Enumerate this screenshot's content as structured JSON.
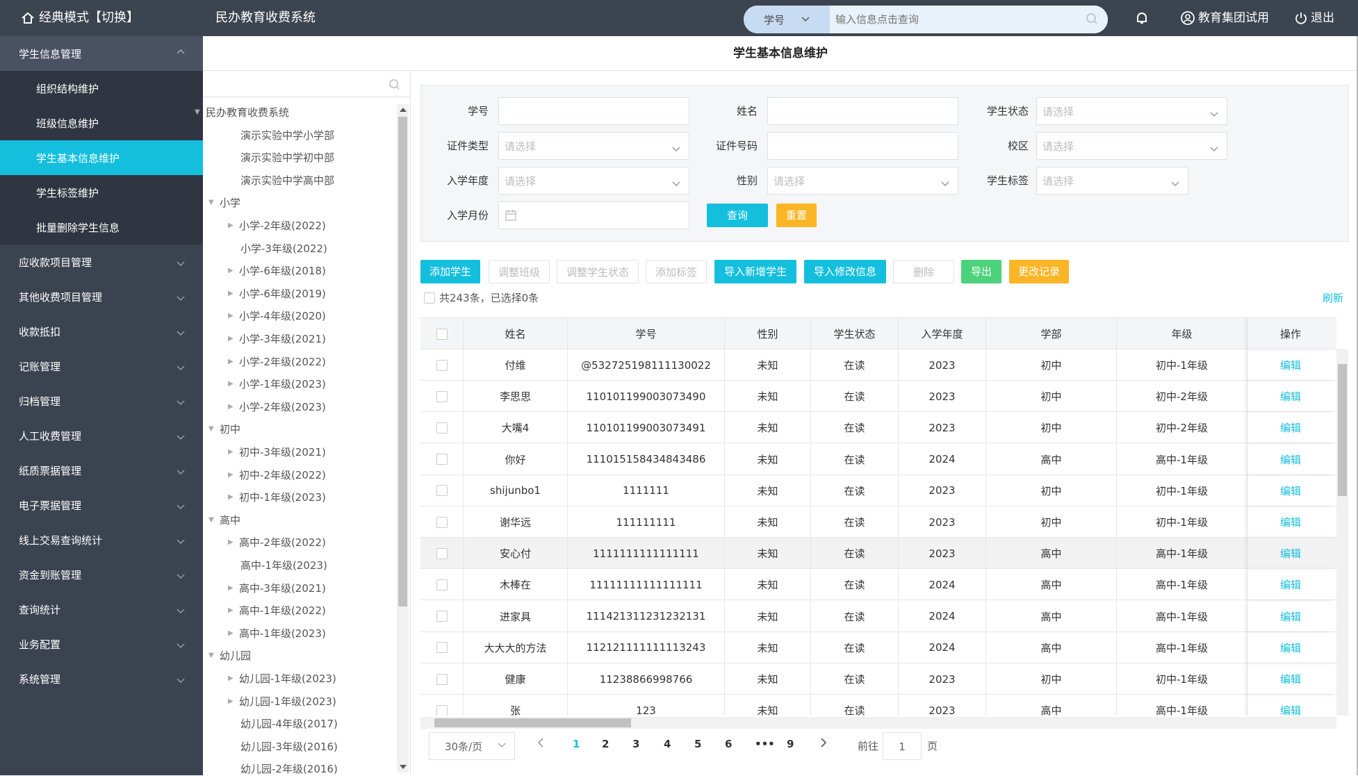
{
  "topbar": {
    "mode_label": "经典模式【切换】",
    "system_name": "民办教育收费系统",
    "search_field": "学号",
    "search_placeholder": "输入信息点击查询",
    "user": "教育集团试用",
    "logout": "退出"
  },
  "sidebar": {
    "open_group": "学生信息管理",
    "sub_items": [
      "组织结构维护",
      "班级信息维护",
      "学生基本信息维护",
      "学生标签维护",
      "批量删除学生信息"
    ],
    "active_sub": "学生基本信息维护",
    "groups": [
      "应收款项目管理",
      "其他收费项目管理",
      "收款抵扣",
      "记账管理",
      "归档管理",
      "人工收费管理",
      "纸质票据管理",
      "电子票据管理",
      "线上交易查询统计",
      "资金到账管理",
      "查询统计",
      "业务配置",
      "系统管理"
    ]
  },
  "page_title": "学生基本信息维护",
  "tree": [
    {
      "label": "民办教育收费系统",
      "level": 0,
      "arrow": "open"
    },
    {
      "label": "演示实验中学小学部",
      "level": 2,
      "arrow": "none"
    },
    {
      "label": "演示实验中学初中部",
      "level": 2,
      "arrow": "none"
    },
    {
      "label": "演示实验中学高中部",
      "level": 2,
      "arrow": "none"
    },
    {
      "label": "小学",
      "level": 1,
      "arrow": "open"
    },
    {
      "label": "小学-2年级(2022)",
      "level": 2,
      "arrow": "closed"
    },
    {
      "label": "小学-3年级(2022)",
      "level": 2,
      "arrow": "none"
    },
    {
      "label": "小学-6年级(2018)",
      "level": 2,
      "arrow": "closed"
    },
    {
      "label": "小学-6年级(2019)",
      "level": 2,
      "arrow": "closed"
    },
    {
      "label": "小学-4年级(2020)",
      "level": 2,
      "arrow": "closed"
    },
    {
      "label": "小学-3年级(2021)",
      "level": 2,
      "arrow": "closed"
    },
    {
      "label": "小学-2年级(2022)",
      "level": 2,
      "arrow": "closed"
    },
    {
      "label": "小学-1年级(2023)",
      "level": 2,
      "arrow": "closed"
    },
    {
      "label": "小学-2年级(2023)",
      "level": 2,
      "arrow": "closed"
    },
    {
      "label": "初中",
      "level": 1,
      "arrow": "open"
    },
    {
      "label": "初中-3年级(2021)",
      "level": 2,
      "arrow": "closed"
    },
    {
      "label": "初中-2年级(2022)",
      "level": 2,
      "arrow": "closed"
    },
    {
      "label": "初中-1年级(2023)",
      "level": 2,
      "arrow": "closed"
    },
    {
      "label": "高中",
      "level": 1,
      "arrow": "open"
    },
    {
      "label": "高中-2年级(2022)",
      "level": 2,
      "arrow": "closed"
    },
    {
      "label": "高中-1年级(2023)",
      "level": 2,
      "arrow": "none"
    },
    {
      "label": "高中-3年级(2021)",
      "level": 2,
      "arrow": "closed"
    },
    {
      "label": "高中-1年级(2022)",
      "level": 2,
      "arrow": "closed"
    },
    {
      "label": "高中-1年级(2023)",
      "level": 2,
      "arrow": "closed"
    },
    {
      "label": "幼儿园",
      "level": 1,
      "arrow": "open"
    },
    {
      "label": "幼儿园-1年级(2023)",
      "level": 2,
      "arrow": "closed"
    },
    {
      "label": "幼儿园-1年级(2023)",
      "level": 2,
      "arrow": "closed"
    },
    {
      "label": "幼儿园-4年级(2017)",
      "level": 2,
      "arrow": "none"
    },
    {
      "label": "幼儿园-3年级(2016)",
      "level": 2,
      "arrow": "none"
    },
    {
      "label": "幼儿园-2年级(2016)",
      "level": 2,
      "arrow": "none"
    }
  ],
  "filter": {
    "student_no_label": "学号",
    "name_label": "姓名",
    "status_label": "学生状态",
    "id_type_label": "证件类型",
    "id_no_label": "证件号码",
    "campus_label": "校区",
    "year_label": "入学年度",
    "gender_label": "性别",
    "tag_label": "学生标签",
    "month_label": "入学月份",
    "select_placeholder": "请选择",
    "query_button": "查询",
    "reset_button": "重置"
  },
  "actions": {
    "add": "添加学生",
    "adjust_class": "调整班级",
    "adjust_status": "调整学生状态",
    "add_tag": "添加标签",
    "import_new": "导入新增学生",
    "import_modify": "导入修改信息",
    "delete": "删除",
    "export": "导出",
    "change_log": "更改记录"
  },
  "summary": "共243条，已选择0条",
  "refresh": "刷新",
  "columns": [
    "姓名",
    "学号",
    "性别",
    "学生状态",
    "入学年度",
    "学部",
    "年级",
    "操作"
  ],
  "rows": [
    {
      "name": "付维",
      "no": "@532725198111130022",
      "gender": "未知",
      "status": "在读",
      "year": "2023",
      "dept": "初中",
      "grade": "初中-1年级",
      "op": "编辑"
    },
    {
      "name": "李思思",
      "no": "110101199003073490",
      "gender": "未知",
      "status": "在读",
      "year": "2023",
      "dept": "初中",
      "grade": "初中-2年级",
      "op": "编辑"
    },
    {
      "name": "大嘴4",
      "no": "110101199003073491",
      "gender": "未知",
      "status": "在读",
      "year": "2023",
      "dept": "初中",
      "grade": "初中-2年级",
      "op": "编辑"
    },
    {
      "name": "你好",
      "no": "111015158434843486",
      "gender": "未知",
      "status": "在读",
      "year": "2024",
      "dept": "高中",
      "grade": "高中-1年级",
      "op": "编辑"
    },
    {
      "name": "shijunbo1",
      "no": "1111111",
      "gender": "未知",
      "status": "在读",
      "year": "2023",
      "dept": "初中",
      "grade": "初中-1年级",
      "op": "编辑"
    },
    {
      "name": "谢华远",
      "no": "111111111",
      "gender": "未知",
      "status": "在读",
      "year": "2023",
      "dept": "初中",
      "grade": "初中-1年级",
      "op": "编辑"
    },
    {
      "name": "安心付",
      "no": "1111111111111111",
      "gender": "未知",
      "status": "在读",
      "year": "2023",
      "dept": "高中",
      "grade": "高中-1年级",
      "op": "编辑"
    },
    {
      "name": "木棒在",
      "no": "11111111111111111",
      "gender": "未知",
      "status": "在读",
      "year": "2024",
      "dept": "高中",
      "grade": "高中-1年级",
      "op": "编辑"
    },
    {
      "name": "进家具",
      "no": "111421311231232131",
      "gender": "未知",
      "status": "在读",
      "year": "2024",
      "dept": "高中",
      "grade": "高中-1年级",
      "op": "编辑"
    },
    {
      "name": "大大大的方法",
      "no": "112121111111113243",
      "gender": "未知",
      "status": "在读",
      "year": "2024",
      "dept": "高中",
      "grade": "高中-1年级",
      "op": "编辑"
    },
    {
      "name": "健康",
      "no": "11238866998766",
      "gender": "未知",
      "status": "在读",
      "year": "2023",
      "dept": "初中",
      "grade": "初中-1年级",
      "op": "编辑"
    },
    {
      "name": "张",
      "no": "123",
      "gender": "未知",
      "status": "在读",
      "year": "2023",
      "dept": "高中",
      "grade": "高中-1年级",
      "op": "编辑"
    }
  ],
  "pagination": {
    "page_size": "30条/页",
    "pages": [
      "1",
      "2",
      "3",
      "4",
      "5",
      "6",
      "•••",
      "9"
    ],
    "current": "1",
    "goto_prefix": "前往",
    "goto_value": "1",
    "goto_suffix": "页"
  }
}
